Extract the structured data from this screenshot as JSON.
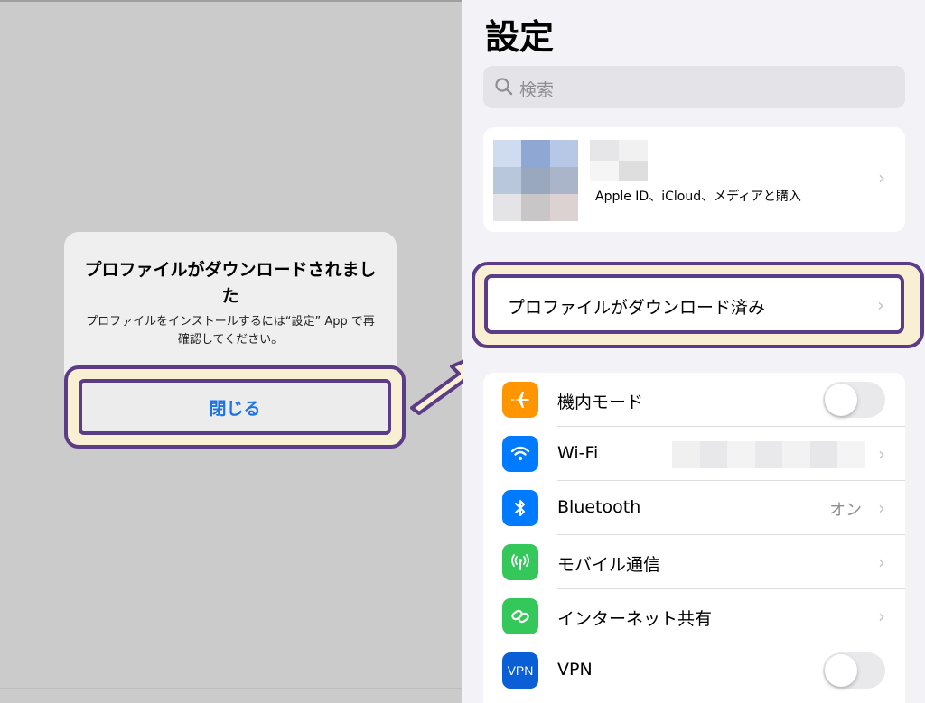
{
  "alert": {
    "title": "プロファイルがダウンロードされました",
    "message": "プロファイルをインストールするには“設定” App で再確認してください。",
    "close_label": "閉じる"
  },
  "settings": {
    "title": "設定",
    "search_placeholder": "検索",
    "account_label": "Apple ID、iCloud、メディアと購入",
    "profile_downloaded_label": "プロファイルがダウンロード済み",
    "rows": [
      {
        "label": "機内モード",
        "icon": "airplane-icon",
        "color": "#ff9500",
        "control": "toggle",
        "on": false
      },
      {
        "label": "Wi-Fi",
        "icon": "wifi-icon",
        "color": "#007aff",
        "control": "chevron",
        "value": ""
      },
      {
        "label": "Bluetooth",
        "icon": "bluetooth-icon",
        "color": "#007aff",
        "control": "chevron",
        "value": "オン"
      },
      {
        "label": "モバイル通信",
        "icon": "antenna-icon",
        "color": "#34c759",
        "control": "chevron",
        "value": ""
      },
      {
        "label": "インターネット共有",
        "icon": "link-icon",
        "color": "#34c759",
        "control": "chevron",
        "value": ""
      },
      {
        "label": "VPN",
        "icon": "vpn-icon",
        "color": "#0a5fd6",
        "control": "toggle",
        "on": false,
        "icon_text": "VPN"
      }
    ]
  },
  "colors": {
    "highlight_border": "#5a3c87",
    "highlight_fill": "#f9efd3",
    "link_blue": "#1a73e8"
  }
}
